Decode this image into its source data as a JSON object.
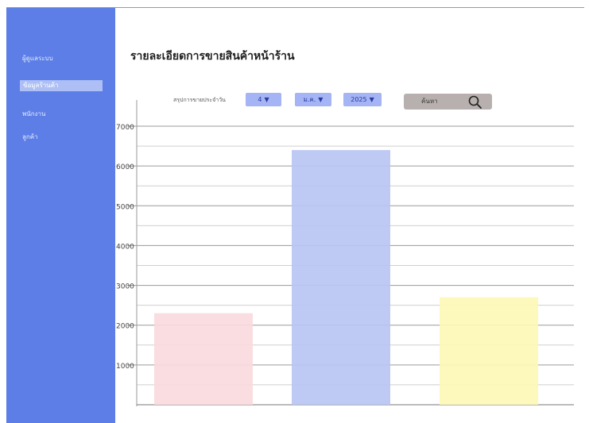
{
  "sidebar": {
    "items": [
      {
        "label": "ผู้ดูแลระบบ",
        "active": false
      },
      {
        "label": "ข้อมูลร้านค้า",
        "active": true
      },
      {
        "label": "พนักงาน",
        "active": false
      },
      {
        "label": "ลูกค้า",
        "active": false
      }
    ]
  },
  "header": {
    "title": "รายละเอียดการขายสินค้าหน้าร้าน"
  },
  "filters": {
    "label": "สรุปการขายประจำวัน",
    "day": "4",
    "month": "ม.ค.",
    "year": "2025",
    "search_placeholder": "ค้นหา"
  },
  "colors": {
    "sidebar": "#5c7ee6",
    "select": "#a4b4f4",
    "bar_1": "#fadadd",
    "bar_2": "#b9c6f2",
    "bar_3": "#fdf7b5"
  },
  "chart_data": {
    "type": "bar",
    "title": "",
    "xlabel": "",
    "ylabel": "",
    "categories": [
      "",
      "",
      ""
    ],
    "values": [
      2300,
      6400,
      2700
    ],
    "bar_colors": [
      "#fadadd",
      "#b9c6f2",
      "#fdf7b5"
    ],
    "ylim": [
      0,
      7000
    ],
    "yticks": [
      1000,
      2000,
      3000,
      4000,
      5000,
      6000,
      7000
    ],
    "ytick_labels": [
      "1000",
      "2000",
      "3000",
      "4000",
      "5000",
      "6000",
      "7000"
    ],
    "grid": true,
    "legend": "none"
  }
}
